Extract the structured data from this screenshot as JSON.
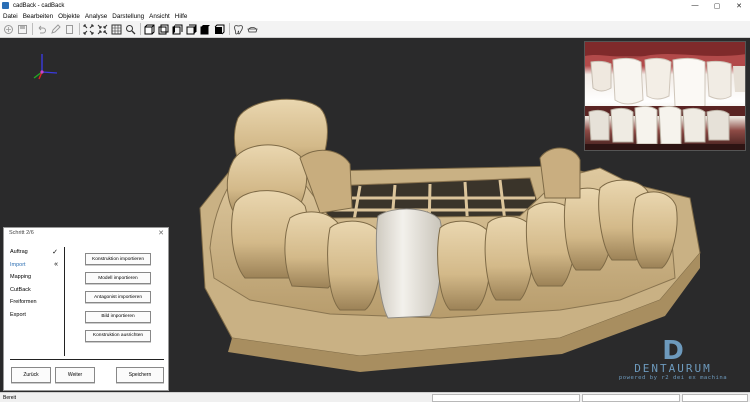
{
  "window": {
    "title": "cadBack - cadBack",
    "min_glyph": "—",
    "max_glyph": "▢",
    "close_glyph": "✕"
  },
  "menu": {
    "items": [
      "Datei",
      "Bearbeiten",
      "Objekte",
      "Analyse",
      "Darstellung",
      "Ansicht",
      "Hilfe"
    ]
  },
  "toolbar": {
    "icons": [
      "open-icon",
      "save-icon",
      "undo-icon",
      "edit-icon",
      "erase-icon",
      "fit-view-icon",
      "collapse-view-icon",
      "grid-icon",
      "zoom-icon",
      "view-front-icon",
      "view-back-icon",
      "view-left-icon",
      "view-right-icon",
      "view-top-icon",
      "view-bottom-icon",
      "tooth-icon",
      "tray-icon"
    ]
  },
  "colors": {
    "viewport_bg": "#2a2a2b",
    "model": "#d8c39c",
    "model_shadow": "#8a7550",
    "crown": "#e9e6df",
    "active_step": "#2d6fb3",
    "brand": "#6d9abd"
  },
  "brand": {
    "logo_letter": "D",
    "name": "DENTAURUM",
    "tagline": "powered by r2 dei ex machina"
  },
  "wizard": {
    "title": "Schritt 2/6",
    "close_glyph": "✕",
    "steps": [
      {
        "label": "Auftrag",
        "mark": "✓",
        "active": false
      },
      {
        "label": "Import",
        "mark": "«",
        "active": true
      },
      {
        "label": "Mapping",
        "mark": "",
        "active": false
      },
      {
        "label": "CutBack",
        "mark": "",
        "active": false
      },
      {
        "label": "Freiformen",
        "mark": "",
        "active": false
      },
      {
        "label": "Export",
        "mark": "",
        "active": false
      }
    ],
    "actions": [
      "Konstruktion importieren",
      "Modell importieren",
      "Antagonist importieren",
      "Bild importieren",
      "Konstruktion ausrichten"
    ],
    "back_label": "Zurück",
    "next_label": "Weiter",
    "save_label": "Speichern"
  },
  "statusbar": {
    "text": "Bereit"
  }
}
